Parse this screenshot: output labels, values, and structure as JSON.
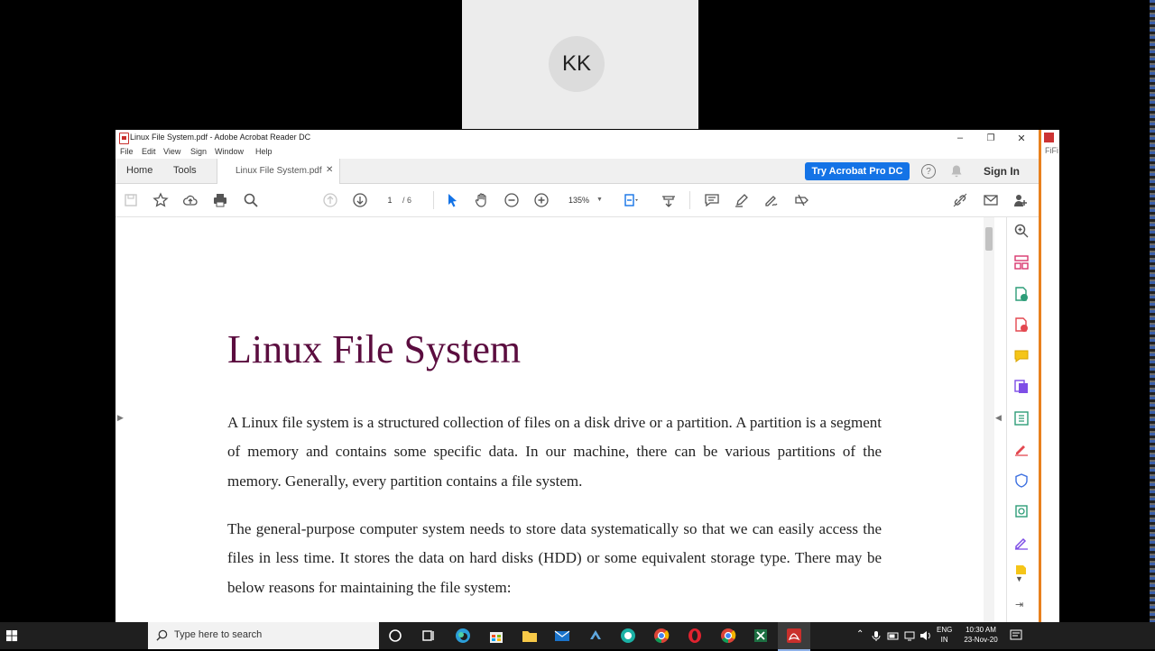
{
  "meeting": {
    "avatar_initials": "KK"
  },
  "other_window": {
    "title_fragment": "FiFi"
  },
  "window": {
    "title": "Linux File System.pdf - Adobe Acrobat Reader DC",
    "controls": {
      "minimize": "–",
      "restore": "❐",
      "close": "✕"
    }
  },
  "menubar": [
    "File",
    "Edit",
    "View",
    "Sign",
    "Window",
    "Help"
  ],
  "tabs": {
    "home": "Home",
    "tools": "Tools",
    "document": "Linux File System.pdf",
    "close_glyph": "✕"
  },
  "header_actions": {
    "try_pro": "Try Acrobat Pro DC",
    "help": "?",
    "sign_in": "Sign In"
  },
  "toolbar": {
    "page_current": "1",
    "page_total": "/ 6",
    "zoom": "135%"
  },
  "document": {
    "title": "Linux File System",
    "paragraphs": [
      "A Linux file system is a structured collection of files on a disk drive or a partition. A partition is a segment of memory and contains some specific data. In our machine, there can be various partitions of the memory. Generally, every partition contains a file system.",
      "The general-purpose computer system needs to store data systematically so that we can easily access the files in less time. It stores the data on hard disks (HDD) or some equivalent storage type. There may be below reasons for maintaining the file system:"
    ]
  },
  "taskbar": {
    "search_placeholder": "Type here to search",
    "language": [
      "ENG",
      "IN"
    ],
    "time": "10:30 AM",
    "date": "23-Nov-20"
  },
  "colors": {
    "acrobat_blue": "#1473e6",
    "title_maroon": "#5b0d3f",
    "window_accent": "#e8801d"
  }
}
